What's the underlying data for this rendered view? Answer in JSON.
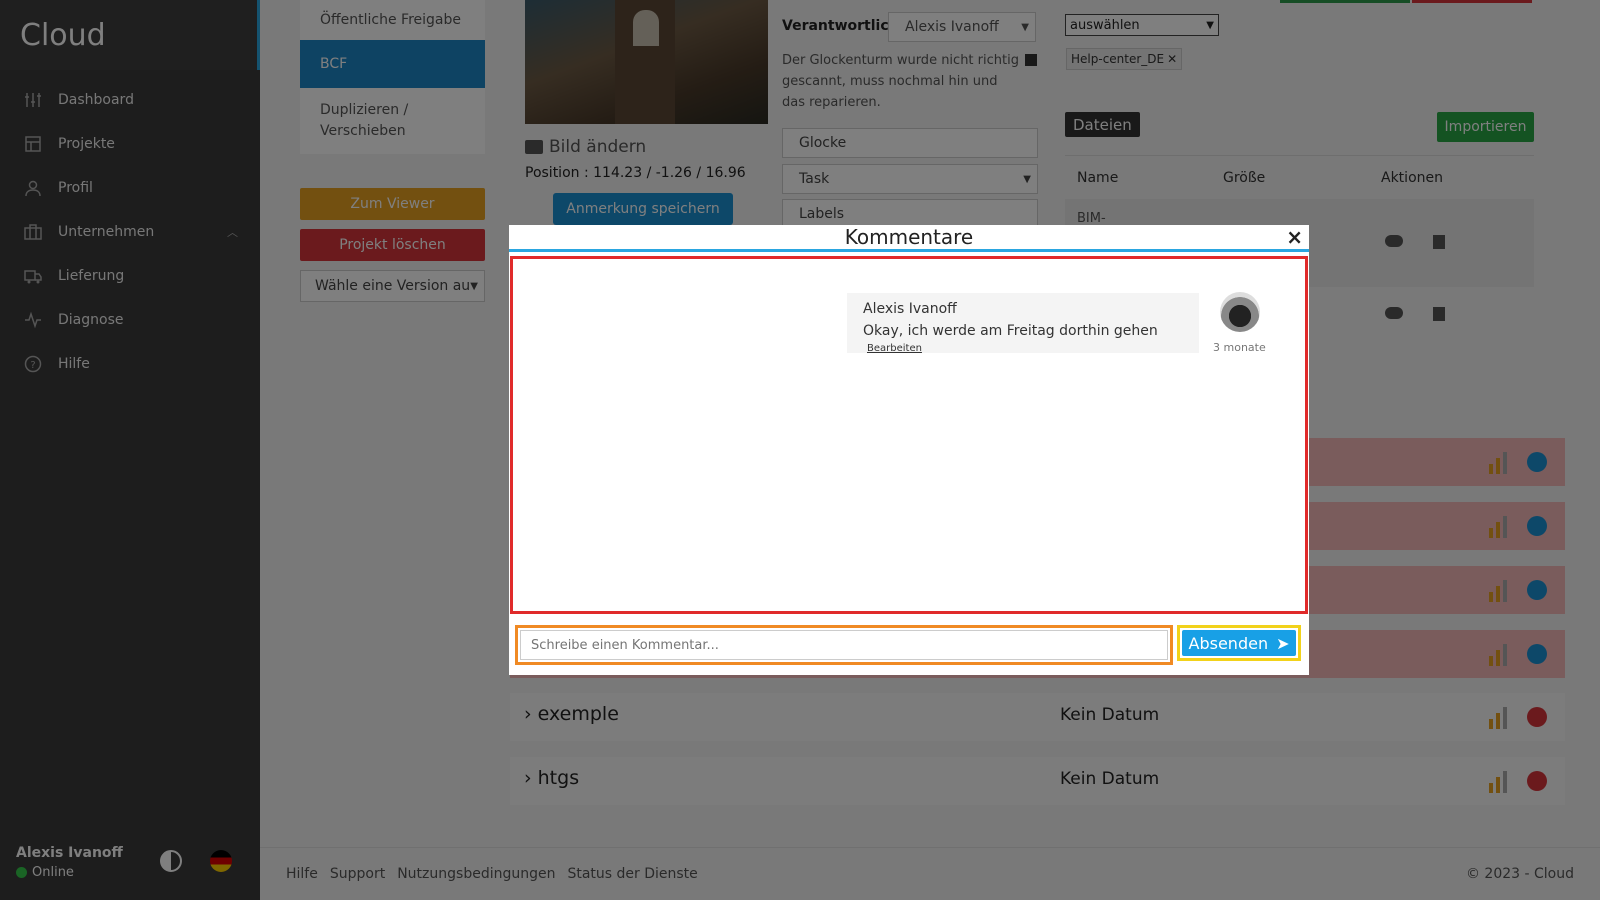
{
  "app": {
    "brand": "Cloud"
  },
  "sidebar": {
    "items": [
      {
        "label": "Dashboard",
        "icon": "sliders-icon"
      },
      {
        "label": "Projekte",
        "icon": "layout-icon"
      },
      {
        "label": "Profil",
        "icon": "user-icon"
      },
      {
        "label": "Unternehmen",
        "icon": "briefcase-icon"
      },
      {
        "label": "Lieferung",
        "icon": "truck-icon"
      },
      {
        "label": "Diagnose",
        "icon": "activity-icon"
      },
      {
        "label": "Hilfe",
        "icon": "help-icon"
      }
    ],
    "user_name": "Alexis Ivanoff",
    "user_status": "Online"
  },
  "project_menu": {
    "items": [
      "Öffentliche Freigabe",
      "BCF",
      "Duplizieren / Verschieben"
    ],
    "viewer_button": "Zum Viewer",
    "delete_button": "Projekt löschen",
    "version_select": "Wähle eine Version au"
  },
  "bcf": {
    "change_image": "Bild ändern",
    "position": "Position : 114.23 / -1.26 / 16.96",
    "save_note": "Anmerkung speichern",
    "responsible_label": "Verantwortlich :",
    "responsible_value": "Alexis Ivanoff",
    "description": "Der Glockenturm wurde nicht richtig gescannt, muss nochmal hin und das reparieren.",
    "title_field": "Glocke",
    "type_field": "Task",
    "labels_field": "Labels",
    "choose_select": "auswählen",
    "tag": "Help-center_DE"
  },
  "files": {
    "badge": "Dateien",
    "import_button": "Importieren",
    "col_name": "Name",
    "col_size": "Größe",
    "col_actions": "Aktionen",
    "row1_name": "BIM-"
  },
  "issues": [
    {
      "name": "exemple",
      "date": "Kein Datum"
    },
    {
      "name": "htgs",
      "date": "Kein Datum"
    }
  ],
  "footer": {
    "links": [
      "Hilfe",
      "Support",
      "Nutzungsbedingungen",
      "Status der Dienste"
    ],
    "copyright": "© 2023 - Cloud"
  },
  "modal": {
    "title": "Kommentare",
    "close": "×",
    "comment_author": "Alexis Ivanoff",
    "comment_text": "Okay, ich werde am Freitag dorthin gehen",
    "comment_edit": "Bearbeiten",
    "comment_time": "3 monate",
    "input_placeholder": "Schreibe einen Kommentar...",
    "send_button": "Absenden"
  }
}
